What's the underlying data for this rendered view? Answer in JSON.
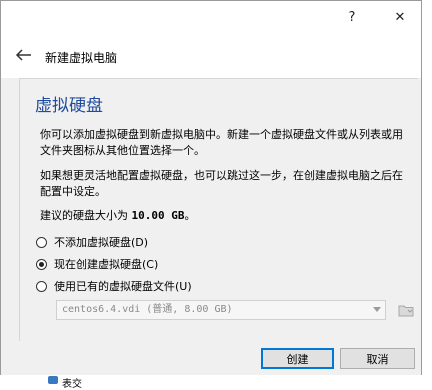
{
  "titlebar": {
    "help_label": "?",
    "close_label": "✕"
  },
  "wizard": {
    "title": "新建虚拟电脑"
  },
  "page": {
    "heading": "虚拟硬盘",
    "para1": "你可以添加虚拟硬盘到新虚拟电脑中。新建一个虚拟硬盘文件或从列表或用文件夹图标从其他位置选择一个。",
    "para2": "如果想更灵活地配置虚拟硬盘，也可以跳过这一步，在创建虚拟电脑之后在配置中设定。",
    "recommend_prefix": "建议的硬盘大小为 ",
    "recommend_size": "10.00 GB",
    "recommend_suffix": "。"
  },
  "options": [
    {
      "label": "不添加虚拟硬盘(D)",
      "checked": false
    },
    {
      "label": "现在创建虚拟硬盘(C)",
      "checked": true
    },
    {
      "label": "使用已有的虚拟硬盘文件(U)",
      "checked": false
    }
  ],
  "disk_select": {
    "value": "centos6.4.vdi (普通, 8.00 GB)"
  },
  "footer": {
    "create_label": "创建",
    "cancel_label": "取消"
  },
  "background": {
    "item_label": "表交"
  },
  "icons": {
    "back": "back-arrow-icon",
    "folder": "folder-icon"
  },
  "colors": {
    "heading": "#1f4c9c",
    "accent": "#0078d7"
  }
}
